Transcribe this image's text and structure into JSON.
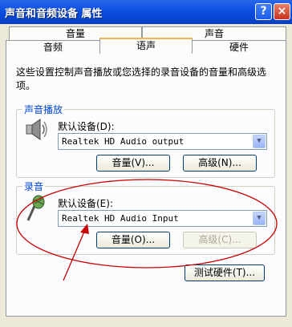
{
  "window": {
    "title": "声音和音频设备 属性",
    "help_button": "?",
    "close_button": "×"
  },
  "tabs": {
    "row_back": [
      "音量",
      "声音"
    ],
    "row_front": [
      "音频",
      "语声",
      "硬件"
    ],
    "active": "语声"
  },
  "description": "这些设置控制声音播放或您选择的录音设备的音量和高级选项。",
  "playback": {
    "group_title": "声音播放",
    "device_label": "默认设备(D):",
    "device_value": "Realtek HD Audio output",
    "volume_button": "音量(V)...",
    "advanced_button": "高级(N)...",
    "icon": "speaker-icon"
  },
  "recording": {
    "group_title": "录音",
    "device_label": "默认设备(E):",
    "device_value": "Realtek HD Audio Input",
    "volume_button": "音量(O)...",
    "advanced_button": "高级(C)...",
    "advanced_disabled": true,
    "icon": "microphone-icon"
  },
  "test_hardware_button": "测试硬件(T)...",
  "annotation": {
    "color": "#c80000",
    "shape": "ellipse-with-arrow"
  }
}
